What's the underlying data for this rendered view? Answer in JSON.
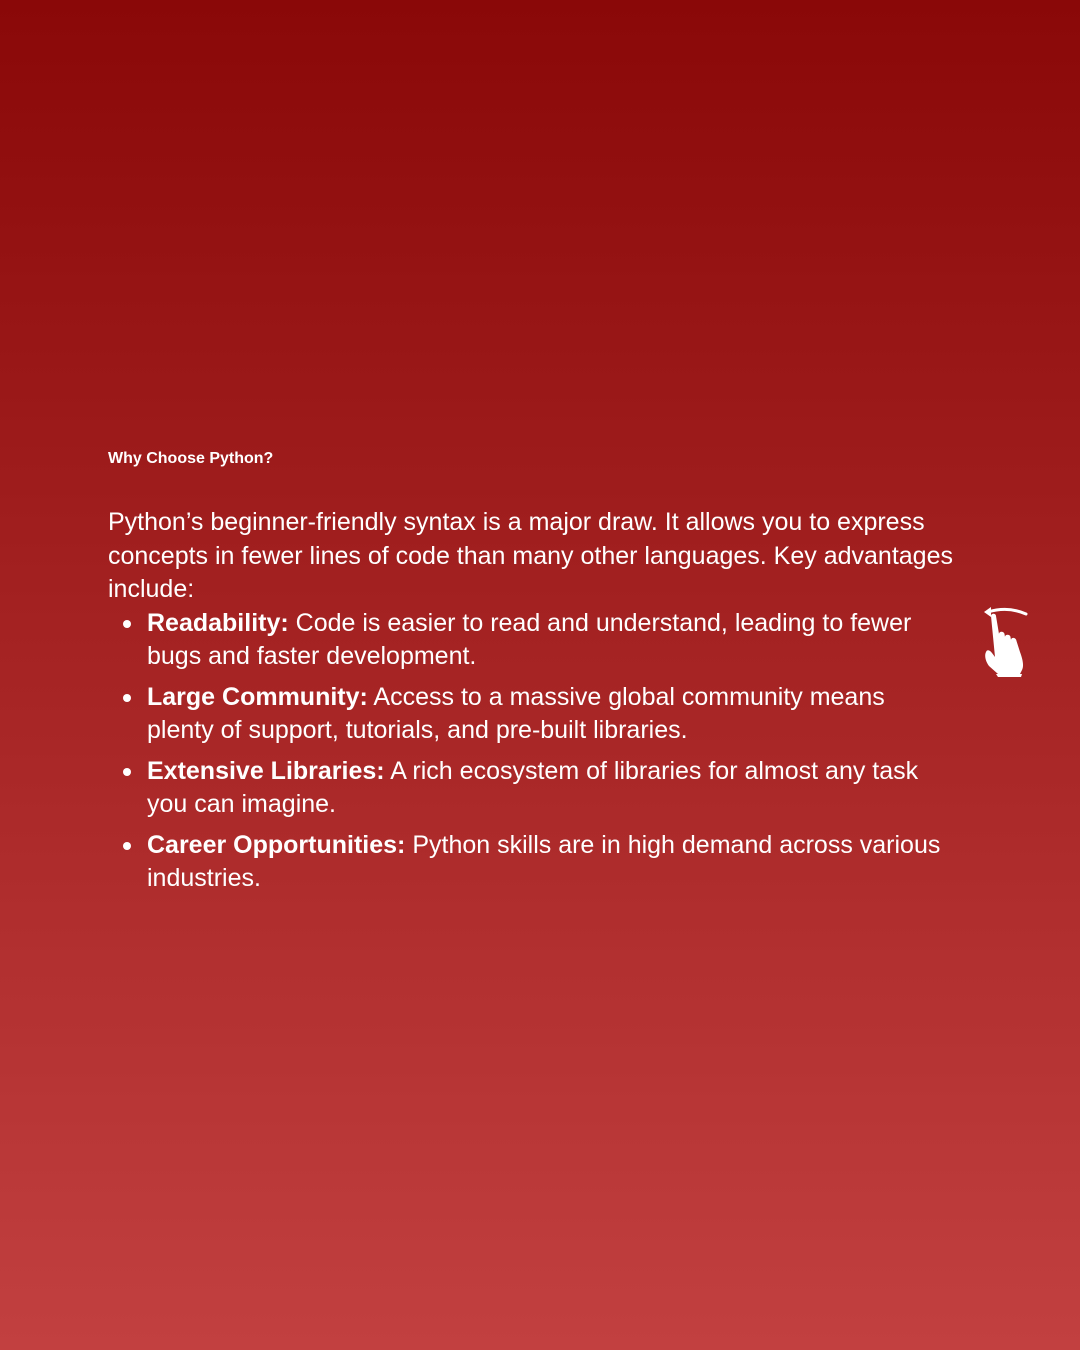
{
  "slide": {
    "title": "Why Choose Python?",
    "intro": "Python’s beginner-friendly syntax is a major draw. It allows you to express concepts in fewer lines of code than many other languages. Key advantages include:",
    "advantages": [
      {
        "term": "Readability:",
        "text": " Code is easier to read and understand, leading to fewer bugs and faster development."
      },
      {
        "term": "Large Community:",
        "text": " Access to a massive global community means plenty of support, tutorials, and pre-built libraries."
      },
      {
        "term": "Extensive Libraries:",
        "text": " A rich ecosystem of libraries for almost any task you can imagine."
      },
      {
        "term": "Career Opportunities:",
        "text": " Python skills are in high demand across various industries."
      }
    ]
  },
  "icons": {
    "swipe_hint": "swipe-hand-icon"
  },
  "colors": {
    "background_top": "#8a0808",
    "background_bottom": "#c24040",
    "text": "#ffffff"
  }
}
